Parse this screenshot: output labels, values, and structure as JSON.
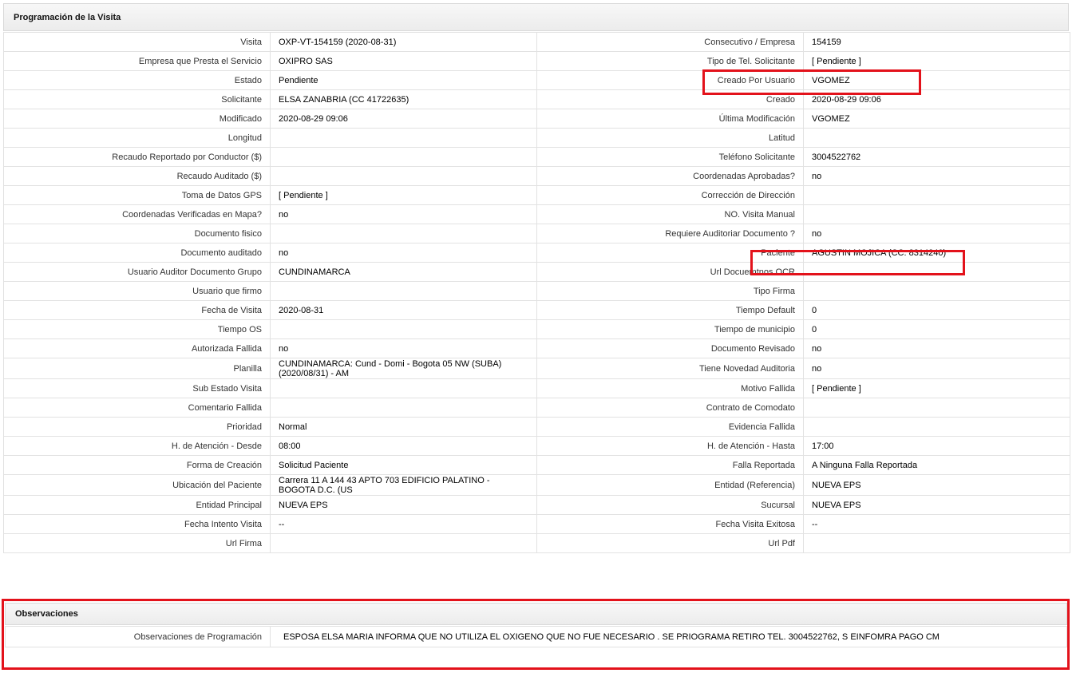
{
  "section_title": "Programación de la Visita",
  "rows": [
    {
      "l1": "Visita",
      "v1": "OXP-VT-154159 (2020-08-31)",
      "l2": "Consecutivo / Empresa",
      "v2": "154159"
    },
    {
      "l1": "Empresa que Presta el Servicio",
      "v1": "OXIPRO SAS",
      "l2": "Tipo de Tel. Solicitante",
      "v2": "[ Pendiente ]"
    },
    {
      "l1": "Estado",
      "v1": "Pendiente",
      "l2": "Creado Por Usuario",
      "v2": "VGOMEZ"
    },
    {
      "l1": "Solicitante",
      "v1": "ELSA ZANABRIA (CC 41722635)",
      "l2": "Creado",
      "v2": "2020-08-29 09:06"
    },
    {
      "l1": "Modificado",
      "v1": "2020-08-29 09:06",
      "l2": "Última Modificación",
      "v2": " VGOMEZ"
    },
    {
      "l1": "Longitud",
      "v1": "",
      "l2": "Latitud",
      "v2": ""
    },
    {
      "l1": "Recaudo Reportado por Conductor ($)",
      "v1": "",
      "l2": "Teléfono Solicitante",
      "v2": "3004522762"
    },
    {
      "l1": "Recaudo Auditado ($)",
      "v1": "",
      "l2": "Coordenadas Aprobadas?",
      "v2": " no"
    },
    {
      "l1": "Toma de Datos GPS",
      "v1": "[ Pendiente ]",
      "l2": "Corrección de Dirección",
      "v2": ""
    },
    {
      "l1": "Coordenadas Verificadas en Mapa?",
      "v1": " no",
      "l2": "NO. Visita Manual",
      "v2": ""
    },
    {
      "l1": "Documento fisico",
      "v1": "",
      "l2": "Requiere Auditoriar Documento ?",
      "v2": " no"
    },
    {
      "l1": "Documento auditado",
      "v1": " no",
      "l2": "Paciente",
      "v2": "AGUSTIN MOJICA (CC: 8314240)"
    },
    {
      "l1": "Usuario Auditor Documento Grupo",
      "v1": "CUNDINAMARCA",
      "l2": "Url Docuemtnos OCR",
      "v2": ""
    },
    {
      "l1": "Usuario que firmo",
      "v1": "",
      "l2": "Tipo Firma",
      "v2": ""
    },
    {
      "l1": "Fecha de Visita",
      "v1": " 2020-08-31",
      "l2": "Tiempo Default",
      "v2": "0"
    },
    {
      "l1": "Tiempo OS",
      "v1": "",
      "l2": "Tiempo de municipio",
      "v2": "0"
    },
    {
      "l1": "Autorizada Fallida",
      "v1": " no",
      "l2": "Documento Revisado",
      "v2": " no"
    },
    {
      "l1": "Planilla",
      "v1": "CUNDINAMARCA: Cund - Domi - Bogota 05 NW (SUBA) (2020/08/31) - AM",
      "l2": "Tiene Novedad Auditoria",
      "v2": " no"
    },
    {
      "l1": "Sub Estado Visita",
      "v1": "",
      "l2": "Motivo Fallida",
      "v2": "[ Pendiente ]"
    },
    {
      "l1": "Comentario Fallida",
      "v1": "",
      "l2": "Contrato de Comodato",
      "v2": ""
    },
    {
      "l1": "Prioridad",
      "v1": "Normal",
      "l2": "Evidencia Fallida",
      "v2": ""
    },
    {
      "l1": "H. de Atención - Desde",
      "v1": "08:00",
      "l2": "H. de Atención - Hasta",
      "v2": "17:00"
    },
    {
      "l1": "Forma de Creación",
      "v1": "Solicitud Paciente",
      "l2": "Falla Reportada",
      "v2": "A Ninguna Falla Reportada"
    },
    {
      "l1": "Ubicación del Paciente",
      "v1": "Carrera 11 A 144 43 APTO 703 EDIFICIO PALATINO - BOGOTA D.C. (US",
      "l2": "Entidad (Referencia)",
      "v2": "NUEVA EPS"
    },
    {
      "l1": "Entidad Principal",
      "v1": "NUEVA EPS",
      "l2": "Sucursal",
      "v2": "NUEVA EPS"
    },
    {
      "l1": "Fecha Intento Visita",
      "v1": " --",
      "l2": "Fecha Visita Exitosa",
      "v2": " --"
    },
    {
      "l1": "Url Firma",
      "v1": "",
      "l2": "Url Pdf",
      "v2": ""
    }
  ],
  "observaciones": {
    "title": "Observaciones",
    "label": "Observaciones de Programación",
    "value": "ESPOSA ELSA MARIA INFORMA QUE NO UTILIZA EL OXIGENO QUE NO FUE NECESARIO . SE PRIOGRAMA RETIRO TEL. 3004522762, S EINFOMRA PAGO CM"
  },
  "colors": {
    "highlight": "#e3121b",
    "header_bg": "#ececec",
    "border": "#e2e2e2"
  }
}
